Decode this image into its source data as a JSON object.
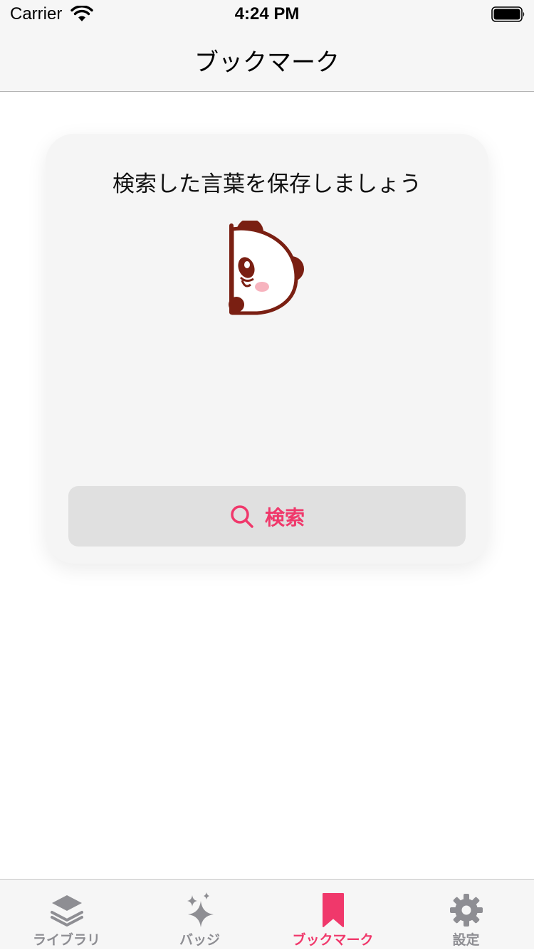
{
  "status_bar": {
    "carrier": "Carrier",
    "time": "4:24 PM"
  },
  "nav": {
    "title": "ブックマーク"
  },
  "empty_state": {
    "message": "検索した言葉を保存しましょう",
    "search_button_label": "検索",
    "search_icon": "search-icon",
    "illustration": "panda-icon"
  },
  "tabs": [
    {
      "label": "ライブラリ",
      "icon": "layers-icon",
      "active": false
    },
    {
      "label": "バッジ",
      "icon": "sparkles-icon",
      "active": false
    },
    {
      "label": "ブックマーク",
      "icon": "bookmark-icon",
      "active": true
    },
    {
      "label": "設定",
      "icon": "gear-icon",
      "active": false
    }
  ],
  "colors": {
    "accent": "#f0386b",
    "inactive": "#8e8e93",
    "panda_brown": "#7a1f12",
    "card_background": "#f5f5f5",
    "button_background": "#e0e0e0"
  }
}
